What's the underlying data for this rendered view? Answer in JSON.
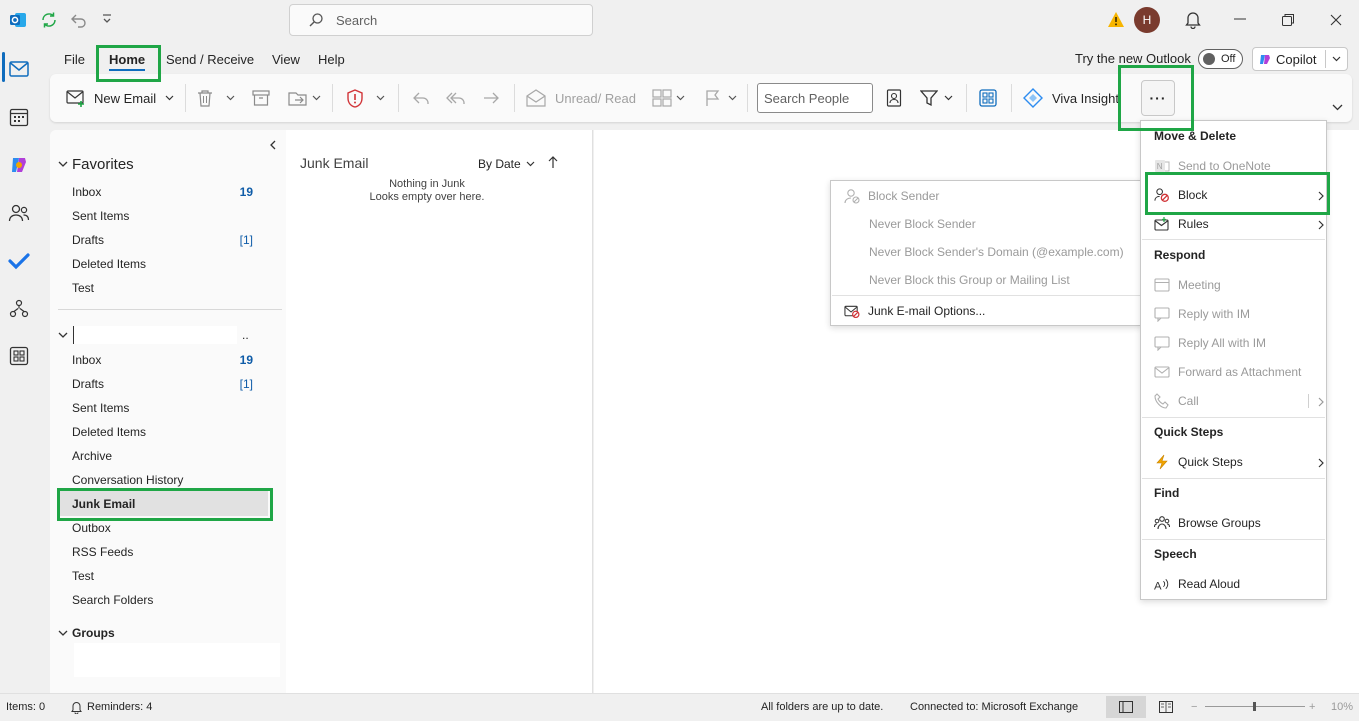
{
  "titlebar": {
    "search_placeholder": "Search",
    "avatar_initial": "H",
    "icons": [
      "outlook-icon",
      "sync-icon",
      "undo-icon",
      "customize-icon",
      "warning-icon",
      "bell-icon",
      "minimize-icon",
      "restore-icon",
      "close-icon"
    ]
  },
  "menu": {
    "tabs": [
      "File",
      "Home",
      "Send / Receive",
      "View",
      "Help"
    ],
    "try_new_outlook": "Try the new Outlook",
    "toggle_state": "Off",
    "copilot": "Copilot"
  },
  "ribbon": {
    "new_email": "New Email",
    "unread_read": "Unread/ Read",
    "search_people_placeholder": "Search People",
    "viva_insights": "Viva Insight",
    "more_button": "···"
  },
  "folders": {
    "favorites_title": "Favorites",
    "favorites": [
      {
        "label": "Inbox",
        "count": "19"
      },
      {
        "label": "Sent Items",
        "count": ""
      },
      {
        "label": "Drafts",
        "count": "[1]"
      },
      {
        "label": "Deleted Items",
        "count": ""
      },
      {
        "label": "Test",
        "count": ""
      }
    ],
    "account_suffix": "..",
    "account": [
      {
        "label": "Inbox",
        "count": "19"
      },
      {
        "label": "Drafts",
        "count": "[1]"
      },
      {
        "label": "Sent Items",
        "count": ""
      },
      {
        "label": "Deleted Items",
        "count": ""
      },
      {
        "label": "Archive",
        "count": ""
      },
      {
        "label": "Conversation History",
        "count": ""
      },
      {
        "label": "Junk Email",
        "count": ""
      },
      {
        "label": "Outbox",
        "count": ""
      },
      {
        "label": "RSS Feeds",
        "count": ""
      },
      {
        "label": "Test",
        "count": ""
      },
      {
        "label": "Search Folders",
        "count": ""
      }
    ],
    "groups_title": "Groups"
  },
  "message_list": {
    "folder_title": "Junk Email",
    "sort_label": "By Date",
    "empty_line1": "Nothing in Junk",
    "empty_line2": "Looks empty over here."
  },
  "block_submenu": {
    "items": [
      "Block Sender",
      "Never Block Sender",
      "Never Block Sender's Domain (@example.com)",
      "Never Block this Group or Mailing List",
      "Junk E-mail Options..."
    ]
  },
  "more_menu": {
    "sections": {
      "move_delete": "Move & Delete",
      "respond": "Respond",
      "quick_steps": "Quick Steps",
      "find": "Find",
      "speech": "Speech"
    },
    "items": {
      "send_onenote": "Send to OneNote",
      "block": "Block",
      "rules": "Rules",
      "meeting": "Meeting",
      "reply_im": "Reply with IM",
      "reply_all_im": "Reply All with IM",
      "forward_attachment": "Forward as Attachment",
      "call": "Call",
      "quick_steps": "Quick Steps",
      "browse_groups": "Browse Groups",
      "read_aloud": "Read Aloud"
    }
  },
  "status": {
    "items": "Items: 0",
    "reminders": "Reminders: 4",
    "sync": "All folders are up to date.",
    "connection": "Connected to: Microsoft Exchange",
    "zoom": "10%"
  },
  "colors": {
    "accent": "#0f6cbd",
    "highlight_box": "#1fa646",
    "block_icon": "#d13438"
  }
}
